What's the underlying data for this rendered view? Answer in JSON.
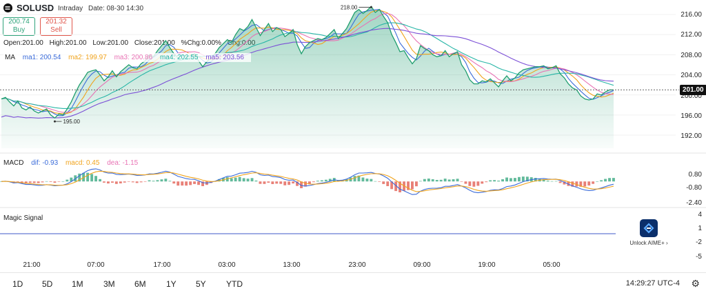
{
  "header": {
    "symbol": "SOLUSD",
    "interval": "Intraday",
    "date_label": "Date: 08-30 14:30",
    "buy_price": "200.74",
    "buy_label": "Buy",
    "sell_price": "201.32",
    "sell_label": "Sell"
  },
  "ohlc": {
    "open": "Open:201.00",
    "high": "High:201.00",
    "low": "Low:201.00",
    "close": "Close:201.00",
    "pct": "%Chg:0.00%",
    "chg": "Chg:0.00"
  },
  "ma_legend": {
    "label": "MA",
    "ma1": "ma1: 200.54",
    "ma2": "ma2: 199.97",
    "ma3": "ma3: 200.86",
    "ma4": "ma4: 202.55",
    "ma5": "ma5: 203.56"
  },
  "macd_legend": {
    "label": "MACD",
    "dif": "dif: -0.93",
    "macd": "macd: 0.45",
    "dea": "dea: -1.15"
  },
  "magic_signal_label": "Magic Signal",
  "price_axis": [
    "216.00",
    "212.00",
    "208.00",
    "204.00",
    "200.00",
    "196.00",
    "192.00"
  ],
  "macd_axis": [
    "0.80",
    "-0.80",
    "-2.40"
  ],
  "magic_axis": [
    "4",
    "1",
    "-2",
    "-5"
  ],
  "last_price": "201.00",
  "high_marker": "218.00",
  "low_marker": "195.00",
  "x_labels": [
    "21:00",
    "07:00",
    "17:00",
    "03:00",
    "13:00",
    "23:00",
    "09:00",
    "19:00",
    "05:00"
  ],
  "periods": [
    "1D",
    "5D",
    "1M",
    "3M",
    "6M",
    "1Y",
    "5Y",
    "YTD"
  ],
  "clock": "14:29:27 UTC-4",
  "aime_label": "Unlock AIME+",
  "colors": {
    "area_line": "#1f9e6e",
    "ma1": "#3a6bd9",
    "ma2": "#f0a31c",
    "ma3": "#e872b4",
    "ma4": "#26b5a6",
    "ma5": "#7b4fd6",
    "up": "#2ea37a",
    "down": "#e0554a"
  },
  "chart_data": {
    "type": "area",
    "title": "SOLUSD",
    "ylim": [
      190,
      218
    ],
    "x_ticks": [
      "21:00",
      "07:00",
      "17:00",
      "03:00",
      "13:00",
      "23:00",
      "09:00",
      "19:00",
      "05:00"
    ],
    "price": [
      199.2,
      199.5,
      198.6,
      197.8,
      198.8,
      197.4,
      197.0,
      197.6,
      196.8,
      196.4,
      196.8,
      197.2,
      196.0,
      195.4,
      196.2,
      196.0,
      197.2,
      198.6,
      200.4,
      202.0,
      203.2,
      204.5,
      204.8,
      205.0,
      204.0,
      202.8,
      203.6,
      204.8,
      203.6,
      204.6,
      205.3,
      206.0,
      205.4,
      205.2,
      206.2,
      206.8,
      208.0,
      207.6,
      208.8,
      209.8,
      210.8,
      209.4,
      208.2,
      207.4,
      208.0,
      207.6,
      207.8,
      208.2,
      206.8,
      205.6,
      206.6,
      207.4,
      208.2,
      209.4,
      210.2,
      211.0,
      210.4,
      212.0,
      213.2,
      212.8,
      213.6,
      215.0,
      213.4,
      211.8,
      213.0,
      214.2,
      212.6,
      213.4,
      213.0,
      211.6,
      212.2,
      213.0,
      210.0,
      208.2,
      209.6,
      210.4,
      210.8,
      211.2,
      211.0,
      211.4,
      212.2,
      213.0,
      211.2,
      212.2,
      213.2,
      214.8,
      216.4,
      217.0,
      216.2,
      216.8,
      217.6,
      216.4,
      217.0,
      215.6,
      214.4,
      212.0,
      210.4,
      208.6,
      208.8,
      207.4,
      206.2,
      207.2,
      209.8,
      209.2,
      208.8,
      208.0,
      207.6,
      207.8,
      208.8,
      207.6,
      208.2,
      208.6,
      206.0,
      204.8,
      203.0,
      202.2,
      202.2,
      202.8,
      202.6,
      203.2,
      202.4,
      201.6,
      202.8,
      203.8,
      202.8,
      203.4,
      204.4,
      205.0,
      205.2,
      205.4,
      205.6,
      205.6,
      205.8,
      205.2,
      205.4,
      205.8,
      204.2,
      203.4,
      202.2,
      201.4,
      201.0,
      199.8,
      199.2,
      199.0,
      199.2,
      200.2,
      200.0,
      200.6,
      201.0,
      201.0
    ],
    "ma_last": {
      "ma1": 200.54,
      "ma2": 199.97,
      "ma3": 200.86,
      "ma4": 202.55,
      "ma5": 203.56
    },
    "macd": {
      "dif_last": -0.93,
      "macd_last": 0.45,
      "dea_last": -1.15,
      "ylim": [
        -2.6,
        1.6
      ]
    },
    "high": 218.0,
    "low": 195.0,
    "last": 201.0
  }
}
